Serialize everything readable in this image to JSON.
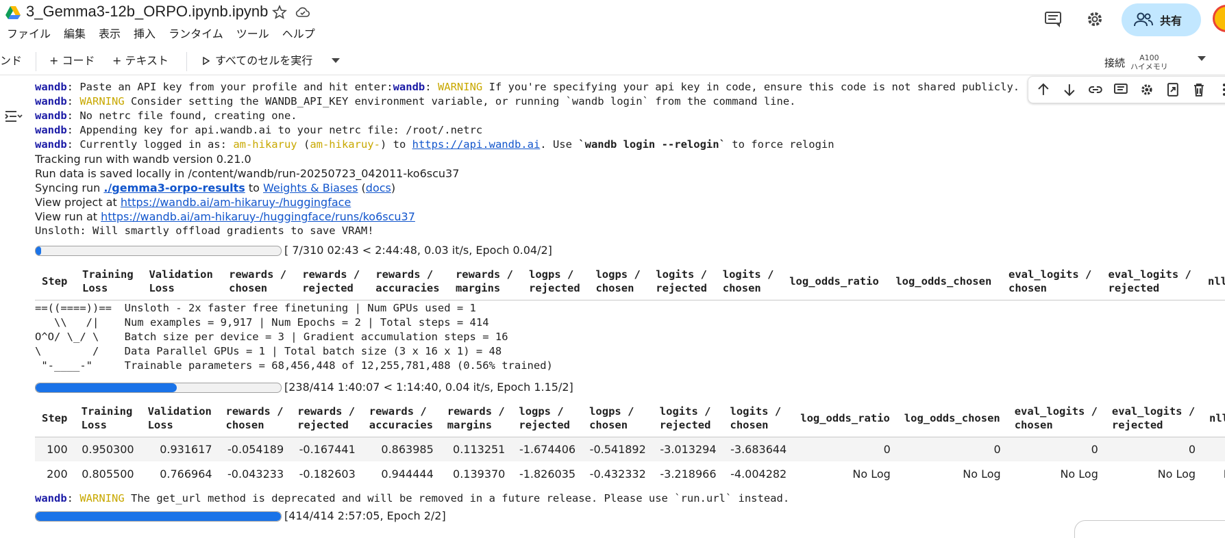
{
  "header": {
    "title": "3_Gemma3-12b_ORPO.ipynb.ipynb",
    "share_label": "共有",
    "menu": [
      "ファイル",
      "編集",
      "表示",
      "挿入",
      "ランタイム",
      "ツール",
      "ヘルプ"
    ]
  },
  "toolbar": {
    "command_partial": "ンド",
    "add_code": "+ コード",
    "add_text": "+ テキスト",
    "run_all": "すべてのセルを実行",
    "connect": "接続",
    "gpu": "A100",
    "memory": "ハイメモリ"
  },
  "output": {
    "l1_prefix": "wandb",
    "l1_text": ": Paste an API key from your profile and hit enter:",
    "l1_prefix2": "wandb",
    "l1_sep": ": ",
    "l1_warn": "WARNING",
    "l1_rest": " If you're specifying your api key in code, ensure this code is not shared publicly.",
    "l2_prefix": "wandb",
    "l2_sep": ": ",
    "l2_warn": "WARNING",
    "l2_rest": " Consider setting the WANDB_API_KEY environment variable, or running `wandb login` from the command line.",
    "l3_prefix": "wandb",
    "l3_rest": ": No netrc file found, creating one.",
    "l4_prefix": "wandb",
    "l4_rest": ": Appending key for api.wandb.ai to your netrc file: /root/.netrc",
    "l5_prefix": "wandb",
    "l5_a": ": Currently logged in as: ",
    "l5_user": "am-hikaruy",
    "l5_b": " (",
    "l5_user2": "am-hikaruy-",
    "l5_c": ") to ",
    "l5_link": "https://api.wandb.ai",
    "l5_d": ". Use ",
    "l5_cmd": "`wandb login --relogin`",
    "l5_e": " to force relogin",
    "tracking": "Tracking run with wandb version 0.21.0",
    "saved": "Run data is saved locally in /content/wandb/run-20250723_042011-ko6scu37",
    "sync_a": "Syncing run ",
    "sync_run": "./gemma3-orpo-results",
    "sync_b": " to ",
    "sync_wb": "Weights & Biases",
    "sync_c": " (",
    "sync_docs": "docs",
    "sync_d": ")",
    "project_a": "View project at ",
    "project_link": "https://wandb.ai/am-hikaruy-/huggingface",
    "run_a": "View run at ",
    "run_link": "https://wandb.ai/am-hikaruy-/huggingface/runs/ko6scu37",
    "unsloth_offload": "Unsloth: Will smartly offload gradients to save VRAM!",
    "progress1": 0.0226,
    "progress1_text": "[ 7/310 02:43 < 2:44:48, 0.03 it/s, Epoch 0.04/2]",
    "banner": [
      "==((====))==  Unsloth - 2x faster free finetuning | Num GPUs used = 1",
      "   \\\\   /|    Num examples = 9,917 | Num Epochs = 2 | Total steps = 414",
      "O^O/ \\_/ \\    Batch size per device = 3 | Gradient accumulation steps = 16",
      "\\        /    Data Parallel GPUs = 1 | Total batch size (3 x 16 x 1) = 48",
      " \"-____-\"     Trainable parameters = 68,456,448 of 12,255,781,488 (0.56% trained)"
    ],
    "progress2": 0.5749,
    "progress2_text": "[238/414 1:40:07 < 1:14:40, 0.04 it/s, Epoch 1.15/2]",
    "warn_prefix": "wandb",
    "warn_sep": ": ",
    "warn_label": "WARNING",
    "warn_rest": " The get_url method is deprecated and will be removed in a future release. Please use `run.url` instead.",
    "progress3": 1.0,
    "progress3_text": "[414/414 2:57:05, Epoch 2/2]"
  },
  "table": {
    "headers": [
      [
        "Step",
        ""
      ],
      [
        "Training",
        "Loss"
      ],
      [
        "Validation",
        "Loss"
      ],
      [
        "rewards /",
        "chosen"
      ],
      [
        "rewards /",
        "rejected"
      ],
      [
        "rewards /",
        "accuracies"
      ],
      [
        "rewards /",
        "margins"
      ],
      [
        "logps /",
        "rejected"
      ],
      [
        "logps /",
        "chosen"
      ],
      [
        "logits /",
        "rejected"
      ],
      [
        "logits /",
        "chosen"
      ],
      [
        "log_odds_ratio",
        ""
      ],
      [
        "log_odds_chosen",
        ""
      ],
      [
        "eval_logits /",
        "chosen"
      ],
      [
        "eval_logits /",
        "rejected"
      ],
      [
        "nll_los",
        ""
      ]
    ],
    "rows": [
      [
        "100",
        "0.950300",
        "0.931617",
        "-0.054189",
        "-0.167441",
        "0.863985",
        "0.113251",
        "-1.674406",
        "-0.541892",
        "-3.013294",
        "-3.683644",
        "0",
        "0",
        "0",
        "0",
        ""
      ],
      [
        "200",
        "0.805500",
        "0.766964",
        "-0.043233",
        "-0.182603",
        "0.944444",
        "0.139370",
        "-1.826035",
        "-0.432332",
        "-3.218966",
        "-4.004282",
        "No Log",
        "No Log",
        "No Log",
        "No Log",
        "No Lo"
      ]
    ]
  }
}
